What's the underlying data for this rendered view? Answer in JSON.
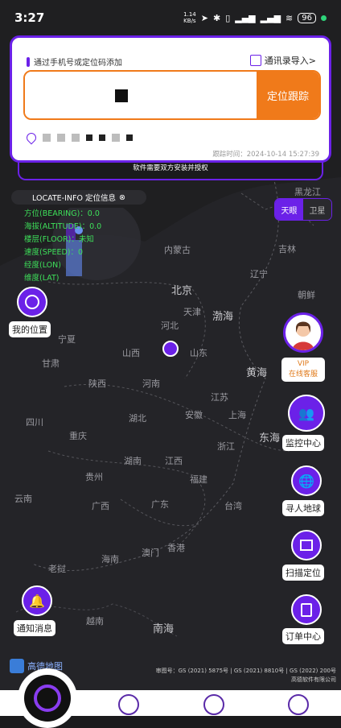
{
  "status": {
    "time": "3:27",
    "speed": "1.14\nKB/s",
    "battery": "96"
  },
  "card": {
    "hint": "通过手机号或定位码添加",
    "import": "通讯录导入>",
    "locate_button": "定位跟踪",
    "track_time": "跟踪时间：2024-10-14 15:27:39"
  },
  "auth_note": "软件需要双方安装并授权",
  "info": {
    "title": "LOCATE-INFO 定位信息",
    "lines": [
      "方位(BEARING)：0.0",
      "海拔(ALTITUDE)：0.0",
      "楼层(FLOOR)：未知",
      "速度(SPEED)：0",
      "经度(LON)",
      "维度(LAT)"
    ]
  },
  "toggle": {
    "on": "天眼",
    "off": "卫星"
  },
  "map_labels": {
    "heilongjiang": "黑龙江",
    "jilin": "吉林",
    "neimenggu": "内蒙古",
    "liaoning": "辽宁",
    "beijing": "北京",
    "tianjin": "天津",
    "bohai": "渤海",
    "hebei": "河北",
    "ningxia": "宁夏",
    "gansu": "甘肃",
    "shanxi": "山西",
    "shandong": "山东",
    "shaanxi": "陕西",
    "henan": "河南",
    "huanghai": "黄海",
    "jiangsu": "江苏",
    "sichuan": "四川",
    "chongqing": "重庆",
    "hubei": "湖北",
    "anhui": "安徽",
    "shanghai": "上海",
    "zhejiang": "浙江",
    "donghai": "东海",
    "hunan": "湖南",
    "jiangxi": "江西",
    "guizhou": "贵州",
    "fujian": "福建",
    "yunnan": "云南",
    "guangxi": "广西",
    "guangdong": "广东",
    "taiwan": "台湾",
    "hainan": "海南",
    "aomen": "澳门",
    "xianggang": "香港",
    "nanhai": "南海",
    "laowo": "老挝",
    "yuenan": "越南",
    "chaoxian": "朝鲜"
  },
  "buttons": {
    "my_location": "我的位置",
    "vip": "VIP",
    "service": "在线客服",
    "monitor": "监控中心",
    "globe": "寻人地球",
    "scan": "扫描定位",
    "notify": "通知消息",
    "orders": "订单中心"
  },
  "copyright": [
    "审图号：GS (2021) 5875号 | GS (2021) 8810号 | GS (2022) 200号",
    "高德软件有限公司"
  ],
  "brand": "高德地图"
}
